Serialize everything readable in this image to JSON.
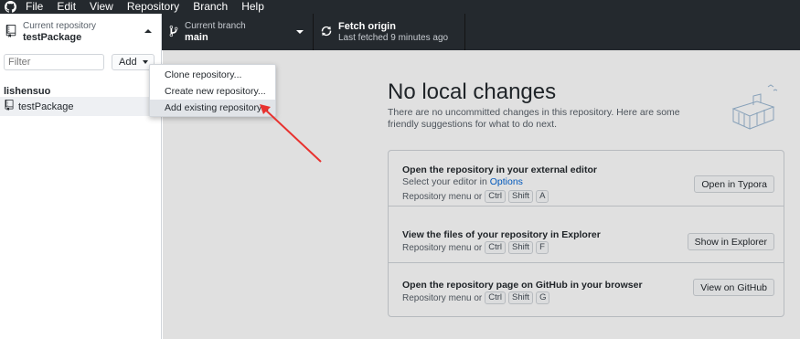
{
  "menubar": {
    "items": [
      "File",
      "Edit",
      "View",
      "Repository",
      "Branch",
      "Help"
    ]
  },
  "toolbar": {
    "repo": {
      "caption": "Current repository",
      "name": "testPackage"
    },
    "branch": {
      "caption": "Current branch",
      "name": "main"
    },
    "fetch": {
      "title": "Fetch origin",
      "subtitle": "Last fetched 9 minutes ago"
    }
  },
  "sidebar": {
    "filter_placeholder": "Filter",
    "add_label": "Add",
    "group": "lishensuo",
    "repos": [
      "testPackage"
    ]
  },
  "dropdown": {
    "items": [
      "Clone repository...",
      "Create new repository...",
      "Add existing repository..."
    ]
  },
  "main": {
    "title": "No local changes",
    "subtitle": "There are no uncommitted changes in this repository. Here are some friendly suggestions for what to do next.",
    "cards": [
      {
        "title": "Open the repository in your external editor",
        "desc_prefix": "Select your editor in ",
        "desc_link": "Options",
        "keys_prefix": "Repository menu or",
        "keys": [
          "Ctrl",
          "Shift",
          "A"
        ],
        "button": "Open in Typora"
      },
      {
        "title": "View the files of your repository in Explorer",
        "keys_prefix": "Repository menu or",
        "keys": [
          "Ctrl",
          "Shift",
          "F"
        ],
        "button": "Show in Explorer"
      },
      {
        "title": "Open the repository page on GitHub in your browser",
        "keys_prefix": "Repository menu or",
        "keys": [
          "Ctrl",
          "Shift",
          "G"
        ],
        "button": "View on GitHub"
      }
    ]
  },
  "colors": {
    "titlebar": "#24292e",
    "accent_link": "#0366d6",
    "annotation_arrow": "#e8322f"
  }
}
